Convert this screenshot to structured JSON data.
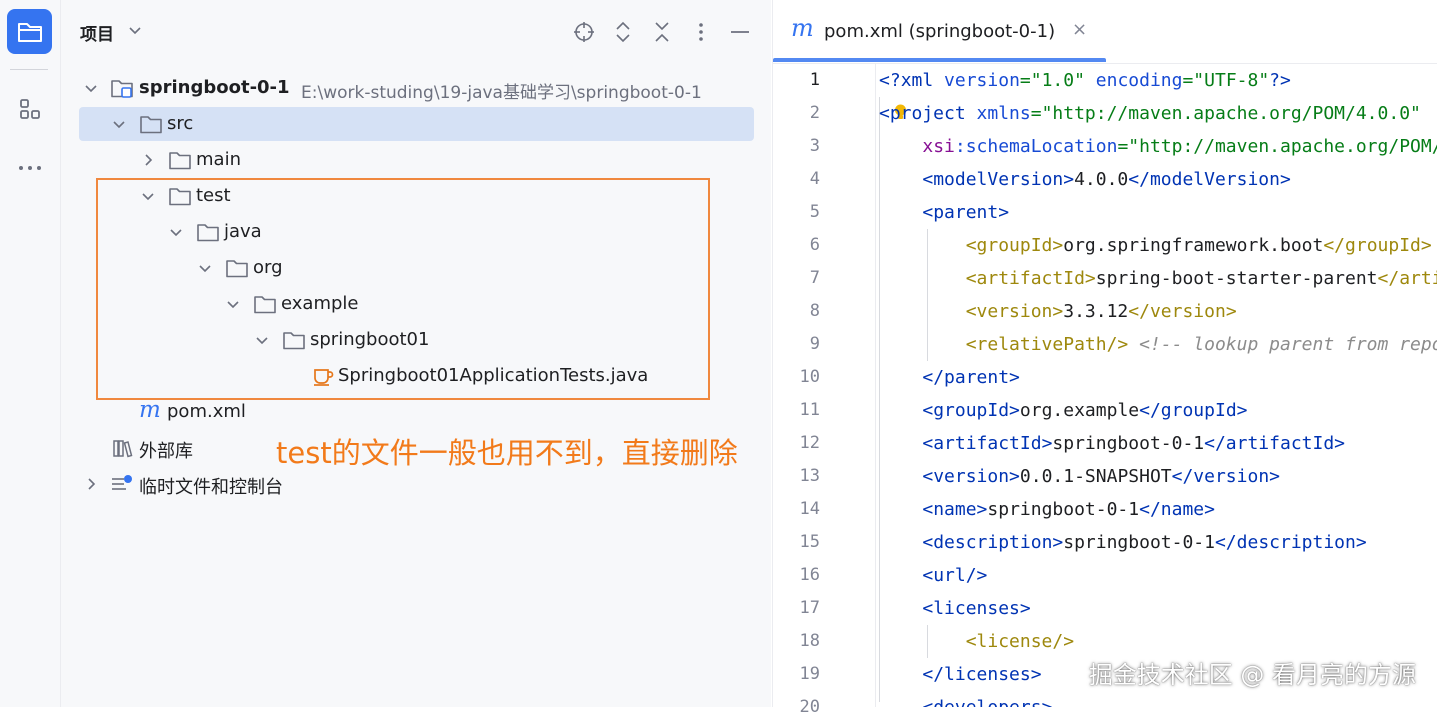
{
  "project_panel": {
    "title": "项目",
    "tree": [
      {
        "label": "springboot-0-1",
        "path": "E:\\work-studing\\19-java基础学习\\springboot-0-1"
      },
      {
        "label": "src"
      },
      {
        "label": "main"
      },
      {
        "label": "test"
      },
      {
        "label": "java"
      },
      {
        "label": "org"
      },
      {
        "label": "example"
      },
      {
        "label": "springboot01"
      },
      {
        "label": "Springboot01ApplicationTests.java"
      },
      {
        "label": "pom.xml"
      },
      {
        "label": "外部库"
      },
      {
        "label": "临时文件和控制台"
      }
    ],
    "maven_glyph": "m"
  },
  "annotation": "test的文件一般也用不到，直接删除",
  "editor": {
    "tab_label": "pom.xml (springboot-0-1)",
    "tab_glyph": "m",
    "tab_close": "×",
    "current_line": 1,
    "line_numbers": [
      "1",
      "2",
      "3",
      "4",
      "5",
      "6",
      "7",
      "8",
      "9",
      "10",
      "11",
      "12",
      "13",
      "14",
      "15",
      "16",
      "17",
      "18",
      "19",
      "20"
    ]
  },
  "watermark": "掘金技术社区 @ 看月亮的方源",
  "colors": {
    "accent": "#3574f0",
    "selection": "#d5e1f5",
    "highlight_box": "#f0883e",
    "annotation": "#f27a1a"
  }
}
